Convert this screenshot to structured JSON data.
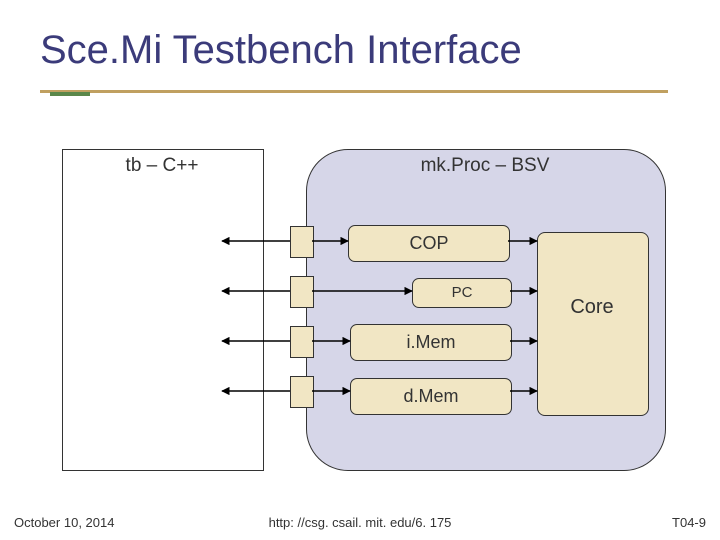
{
  "title": "Sce.Mi Testbench Interface",
  "tb_label": "tb – C++",
  "proc_label": "mk.Proc – BSV",
  "core_label": "Core",
  "modules": {
    "cop": "COP",
    "pc": "PC",
    "imem": "i.Mem",
    "dmem": "d.Mem"
  },
  "footer": {
    "date": "October 10, 2014",
    "url": "http: //csg. csail. mit. edu/6. 175",
    "slide": "T04-9"
  },
  "colors": {
    "title": "#3b3b7a",
    "underline": "#c0a060",
    "accent": "#5a874a",
    "proc_bg": "#d6d6e8",
    "module_bg": "#f1e6c4"
  }
}
